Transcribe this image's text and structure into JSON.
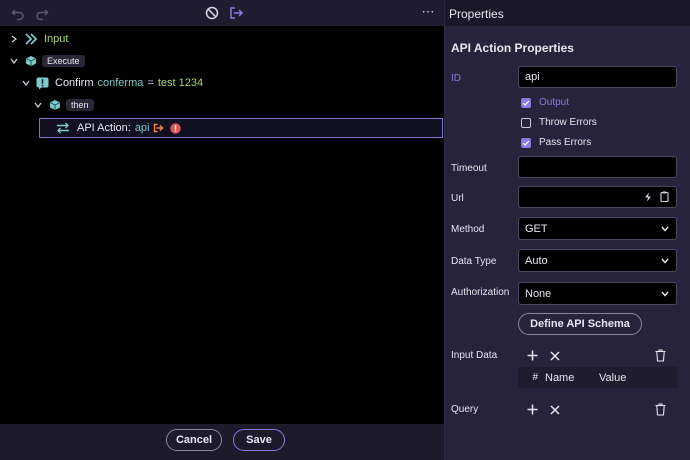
{
  "toolbar": {
    "undo_icon": "undo-icon",
    "redo_icon": "redo-icon",
    "disable_icon": "no-entry-icon",
    "export_icon": "export-icon",
    "more_label": "⋯"
  },
  "tree": {
    "input_label": "Input",
    "execute_label": "Execute",
    "confirm_label": "Confirm",
    "confirm_var": "conferma",
    "confirm_eq": "=",
    "confirm_value": "test 1234",
    "then_label": "then",
    "api_label": "API Action:",
    "api_name": "api"
  },
  "footer": {
    "cancel_label": "Cancel",
    "save_label": "Save"
  },
  "properties": {
    "header": "Properties",
    "title": "API Action Properties",
    "id_label": "ID",
    "id_value": "api",
    "output_label": "Output",
    "throw_errors_label": "Throw Errors",
    "pass_errors_label": "Pass Errors",
    "output_checked": true,
    "throw_errors_checked": false,
    "pass_errors_checked": true,
    "timeout_label": "Timeout",
    "timeout_value": "",
    "url_label": "Url",
    "url_value": "",
    "method_label": "Method",
    "method_value": "GET",
    "data_type_label": "Data Type",
    "data_type_value": "Auto",
    "authorization_label": "Authorization",
    "authorization_value": "None",
    "define_schema_label": "Define API Schema",
    "input_data_label": "Input Data",
    "input_data_columns": [
      "#",
      "Name",
      "Value"
    ],
    "query_label": "Query"
  },
  "colors": {
    "accent": "#8d7ae0",
    "tree_bg": "#000000",
    "panel_bg": "#26233a",
    "teal": "#7ec9c9",
    "green_text": "#a8d67a",
    "warn": "#e05555",
    "orange": "#f0883e"
  }
}
